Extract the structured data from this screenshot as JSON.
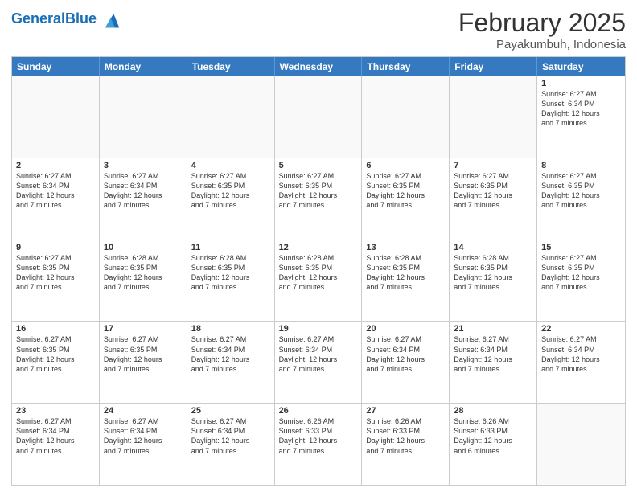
{
  "header": {
    "logo_general": "General",
    "logo_blue": "Blue",
    "month": "February 2025",
    "location": "Payakumbuh, Indonesia"
  },
  "weekdays": [
    "Sunday",
    "Monday",
    "Tuesday",
    "Wednesday",
    "Thursday",
    "Friday",
    "Saturday"
  ],
  "rows": [
    [
      {
        "day": "",
        "info": ""
      },
      {
        "day": "",
        "info": ""
      },
      {
        "day": "",
        "info": ""
      },
      {
        "day": "",
        "info": ""
      },
      {
        "day": "",
        "info": ""
      },
      {
        "day": "",
        "info": ""
      },
      {
        "day": "1",
        "info": "Sunrise: 6:27 AM\nSunset: 6:34 PM\nDaylight: 12 hours\nand 7 minutes."
      }
    ],
    [
      {
        "day": "2",
        "info": "Sunrise: 6:27 AM\nSunset: 6:34 PM\nDaylight: 12 hours\nand 7 minutes."
      },
      {
        "day": "3",
        "info": "Sunrise: 6:27 AM\nSunset: 6:34 PM\nDaylight: 12 hours\nand 7 minutes."
      },
      {
        "day": "4",
        "info": "Sunrise: 6:27 AM\nSunset: 6:35 PM\nDaylight: 12 hours\nand 7 minutes."
      },
      {
        "day": "5",
        "info": "Sunrise: 6:27 AM\nSunset: 6:35 PM\nDaylight: 12 hours\nand 7 minutes."
      },
      {
        "day": "6",
        "info": "Sunrise: 6:27 AM\nSunset: 6:35 PM\nDaylight: 12 hours\nand 7 minutes."
      },
      {
        "day": "7",
        "info": "Sunrise: 6:27 AM\nSunset: 6:35 PM\nDaylight: 12 hours\nand 7 minutes."
      },
      {
        "day": "8",
        "info": "Sunrise: 6:27 AM\nSunset: 6:35 PM\nDaylight: 12 hours\nand 7 minutes."
      }
    ],
    [
      {
        "day": "9",
        "info": "Sunrise: 6:27 AM\nSunset: 6:35 PM\nDaylight: 12 hours\nand 7 minutes."
      },
      {
        "day": "10",
        "info": "Sunrise: 6:28 AM\nSunset: 6:35 PM\nDaylight: 12 hours\nand 7 minutes."
      },
      {
        "day": "11",
        "info": "Sunrise: 6:28 AM\nSunset: 6:35 PM\nDaylight: 12 hours\nand 7 minutes."
      },
      {
        "day": "12",
        "info": "Sunrise: 6:28 AM\nSunset: 6:35 PM\nDaylight: 12 hours\nand 7 minutes."
      },
      {
        "day": "13",
        "info": "Sunrise: 6:28 AM\nSunset: 6:35 PM\nDaylight: 12 hours\nand 7 minutes."
      },
      {
        "day": "14",
        "info": "Sunrise: 6:28 AM\nSunset: 6:35 PM\nDaylight: 12 hours\nand 7 minutes."
      },
      {
        "day": "15",
        "info": "Sunrise: 6:27 AM\nSunset: 6:35 PM\nDaylight: 12 hours\nand 7 minutes."
      }
    ],
    [
      {
        "day": "16",
        "info": "Sunrise: 6:27 AM\nSunset: 6:35 PM\nDaylight: 12 hours\nand 7 minutes."
      },
      {
        "day": "17",
        "info": "Sunrise: 6:27 AM\nSunset: 6:35 PM\nDaylight: 12 hours\nand 7 minutes."
      },
      {
        "day": "18",
        "info": "Sunrise: 6:27 AM\nSunset: 6:34 PM\nDaylight: 12 hours\nand 7 minutes."
      },
      {
        "day": "19",
        "info": "Sunrise: 6:27 AM\nSunset: 6:34 PM\nDaylight: 12 hours\nand 7 minutes."
      },
      {
        "day": "20",
        "info": "Sunrise: 6:27 AM\nSunset: 6:34 PM\nDaylight: 12 hours\nand 7 minutes."
      },
      {
        "day": "21",
        "info": "Sunrise: 6:27 AM\nSunset: 6:34 PM\nDaylight: 12 hours\nand 7 minutes."
      },
      {
        "day": "22",
        "info": "Sunrise: 6:27 AM\nSunset: 6:34 PM\nDaylight: 12 hours\nand 7 minutes."
      }
    ],
    [
      {
        "day": "23",
        "info": "Sunrise: 6:27 AM\nSunset: 6:34 PM\nDaylight: 12 hours\nand 7 minutes."
      },
      {
        "day": "24",
        "info": "Sunrise: 6:27 AM\nSunset: 6:34 PM\nDaylight: 12 hours\nand 7 minutes."
      },
      {
        "day": "25",
        "info": "Sunrise: 6:27 AM\nSunset: 6:34 PM\nDaylight: 12 hours\nand 7 minutes."
      },
      {
        "day": "26",
        "info": "Sunrise: 6:26 AM\nSunset: 6:33 PM\nDaylight: 12 hours\nand 7 minutes."
      },
      {
        "day": "27",
        "info": "Sunrise: 6:26 AM\nSunset: 6:33 PM\nDaylight: 12 hours\nand 7 minutes."
      },
      {
        "day": "28",
        "info": "Sunrise: 6:26 AM\nSunset: 6:33 PM\nDaylight: 12 hours\nand 6 minutes."
      },
      {
        "day": "",
        "info": ""
      }
    ]
  ]
}
